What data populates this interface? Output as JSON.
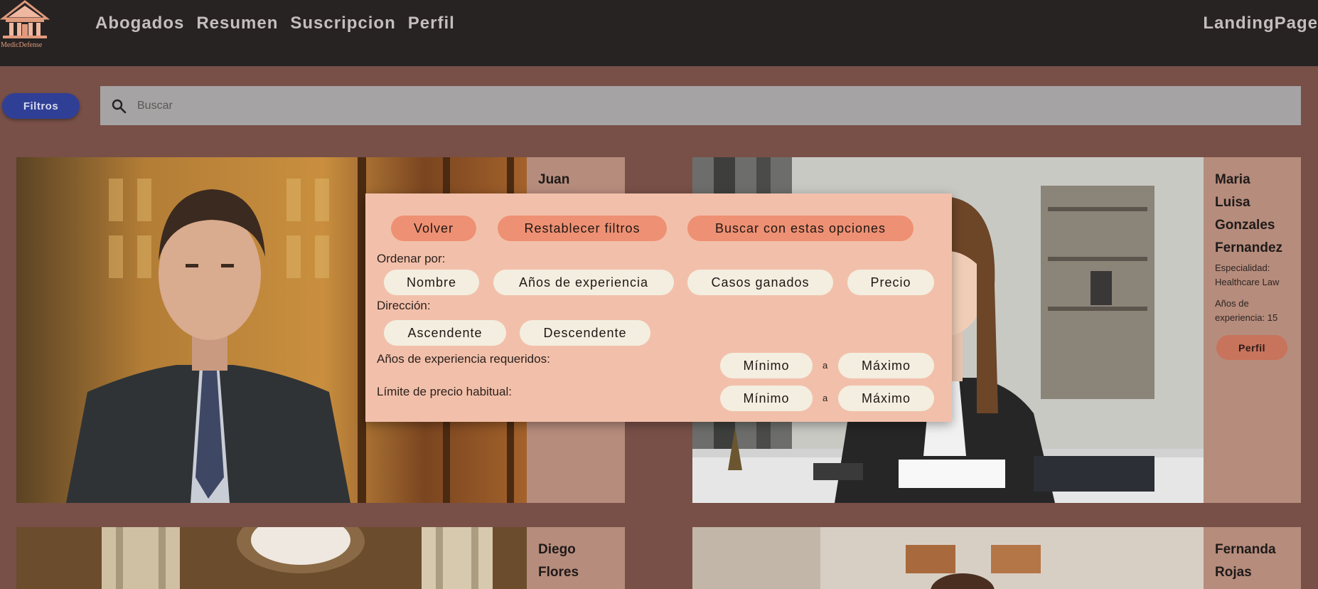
{
  "header": {
    "logo_text": "MedicDefense",
    "nav": [
      "Abogados",
      "Resumen",
      "Suscripcion",
      "Perfil"
    ],
    "right_link": "LandingPage"
  },
  "toolbar": {
    "filters_label": "Filtros",
    "search_placeholder": "Buscar"
  },
  "cards": [
    {
      "name_lines": [
        "Juan"
      ]
    },
    {
      "name_lines": [
        "Maria",
        "Luisa",
        "Gonzales",
        "Fernandez"
      ],
      "specialty": "Especialidad: Healthcare Law",
      "experience": "Años de experiencia: 15",
      "profile_label": "Perfil"
    },
    {
      "name_lines": [
        "Diego",
        "Flores"
      ]
    },
    {
      "name_lines": [
        "Fernanda",
        "Rojas"
      ]
    }
  ],
  "filter_modal": {
    "actions": [
      "Volver",
      "Restablecer filtros",
      "Buscar con estas opciones"
    ],
    "sort_label": "Ordenar por:",
    "sort_options": [
      "Nombre",
      "Años de experiencia",
      "Casos ganados",
      "Precio"
    ],
    "direction_label": "Dirección:",
    "direction_options": [
      "Ascendente",
      "Descendente"
    ],
    "experience_label": "Años de experiencia requeridos:",
    "price_label": "Límite de precio habitual:",
    "min_label": "Mínimo",
    "max_label": "Máximo",
    "range_separator": "a"
  },
  "colors": {
    "topbar": "#272323",
    "page_bg": "#785048",
    "filters_button": "#303f96",
    "modal_bg": "#f2c0aa",
    "action_pill": "#ee9073",
    "option_pill": "#f3eee0",
    "card_info": "#b68c7c"
  }
}
